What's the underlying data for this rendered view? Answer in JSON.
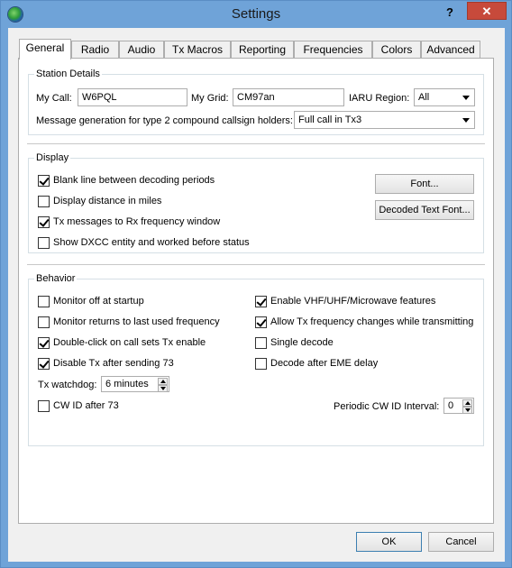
{
  "window": {
    "title": "Settings",
    "help": "?",
    "close": "✕"
  },
  "tabs": [
    "General",
    "Radio",
    "Audio",
    "Tx Macros",
    "Reporting",
    "Frequencies",
    "Colors",
    "Advanced"
  ],
  "station": {
    "title": "Station Details",
    "my_call_label": "My Call:",
    "my_call_value": "W6PQL",
    "my_grid_label": "My Grid:",
    "my_grid_value": "CM97an",
    "iaru_label": "IARU Region:",
    "iaru_value": "All",
    "msg_gen_label": "Message generation for type 2 compound callsign holders:",
    "msg_gen_value": "Full call in Tx3"
  },
  "display": {
    "title": "Display",
    "items": [
      {
        "label": "Blank line between decoding periods",
        "checked": true
      },
      {
        "label": "Display distance in miles",
        "checked": false
      },
      {
        "label": "Tx messages to Rx frequency window",
        "checked": true
      },
      {
        "label": "Show DXCC entity and worked before status",
        "checked": false
      }
    ],
    "font_button": "Font...",
    "decoded_font_button": "Decoded Text Font..."
  },
  "behavior": {
    "title": "Behavior",
    "left": [
      {
        "label": "Monitor off at startup",
        "checked": false
      },
      {
        "label": "Monitor returns to last used frequency",
        "checked": false
      },
      {
        "label": "Double-click on call sets Tx enable",
        "checked": true
      },
      {
        "label": "Disable Tx after sending 73",
        "checked": true
      }
    ],
    "right": [
      {
        "label": "Enable VHF/UHF/Microwave features",
        "checked": true
      },
      {
        "label": "Allow Tx frequency changes while transmitting",
        "checked": true
      },
      {
        "label": "Single decode",
        "checked": false
      },
      {
        "label": "Decode after EME delay",
        "checked": false
      }
    ],
    "tx_watchdog_label": "Tx watchdog:",
    "tx_watchdog_value": "6 minutes",
    "cw_id_label": "CW ID after 73",
    "cw_id_checked": false,
    "periodic_cw_label": "Periodic CW ID Interval:",
    "periodic_cw_value": "0"
  },
  "footer": {
    "ok": "OK",
    "cancel": "Cancel"
  }
}
